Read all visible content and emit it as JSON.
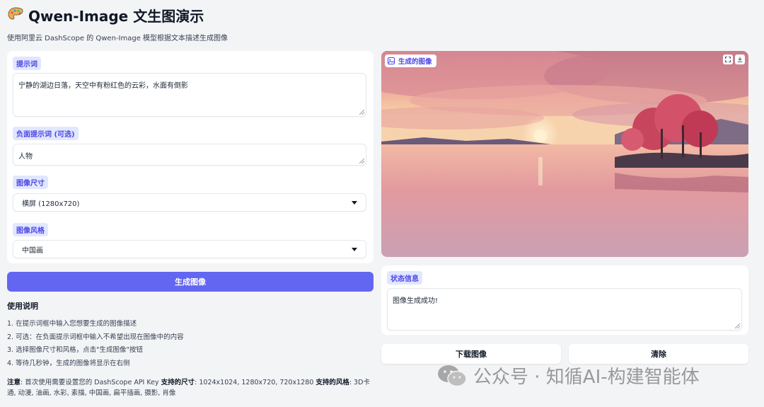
{
  "header": {
    "title": "Qwen-Image 文生图演示",
    "subtitle": "使用阿里云 DashScope 的 Qwen-Image 模型根据文本描述生成图像"
  },
  "form": {
    "prompt": {
      "label": "提示词",
      "value": "宁静的湖边日落，天空中有粉红色的云彩，水面有倒影"
    },
    "negative_prompt": {
      "label": "负面提示词 (可选)",
      "value": "人物"
    },
    "size": {
      "label": "图像尺寸",
      "selected": "横屏 (1280x720)"
    },
    "style": {
      "label": "图像风格",
      "selected": "中国画"
    }
  },
  "generate_button": "生成图像",
  "instructions": {
    "title": "使用说明",
    "items": [
      "1. 在提示词框中输入您想要生成的图像描述",
      "2. 可选：在负面提示词框中输入不希望出现在图像中的内容",
      "3. 选择图像尺寸和风格，点击\"生成图像\"按钮",
      "4. 等待几秒钟，生成的图像将显示在右侧"
    ],
    "note_label": "注意",
    "note_text": ": 首次使用需要设置您的 DashScope API Key ",
    "sizes_label": "支持的尺寸",
    "sizes_text": ": 1024x1024, 1280x720, 720x1280 ",
    "styles_label": "支持的风格",
    "styles_text": ": 3D卡通, 动漫, 油画, 水彩, 素描, 中国画, 扁平插画, 摄影, 肖像"
  },
  "output": {
    "image_label": "生成的图像",
    "status_label": "状态信息",
    "status_value": "图像生成成功!",
    "download_button": "下载图像",
    "clear_button": "清除"
  },
  "watermark": "公众号 · 知循AI-构建智能体",
  "colors": {
    "accent": "#6366f1",
    "pill_bg": "#e0e7ff",
    "pill_text": "#4f46e5",
    "background": "#f3f4f6"
  }
}
